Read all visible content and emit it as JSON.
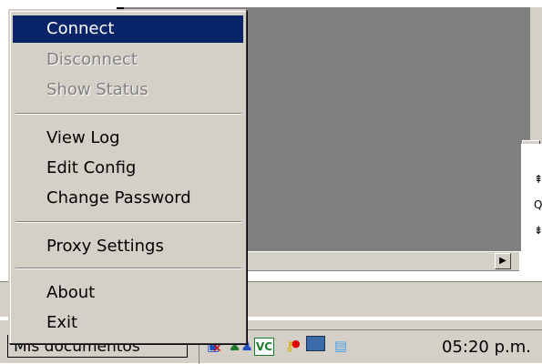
{
  "menu": {
    "items": [
      {
        "label": "Connect",
        "state": "selected"
      },
      {
        "label": "Disconnect",
        "state": "disabled"
      },
      {
        "label": "Show Status",
        "state": "disabled"
      },
      {
        "label": "View Log",
        "state": "normal"
      },
      {
        "label": "Edit Config",
        "state": "normal"
      },
      {
        "label": "Change Password",
        "state": "normal"
      },
      {
        "label": "Proxy Settings",
        "state": "normal"
      },
      {
        "label": "About",
        "state": "normal"
      },
      {
        "label": "Exit",
        "state": "normal"
      }
    ]
  },
  "taskbar": {
    "task_button": "Mis documentos",
    "clock": "05:20 p.m."
  },
  "tray": {
    "icons": [
      "network-disconnected-icon",
      "users-icon",
      "vc-icon",
      "key-icon",
      "monitor-icon",
      "document-icon"
    ]
  },
  "colors": {
    "selection": "#0a246a",
    "face": "#d4d0c8",
    "disabled_text": "#808080"
  }
}
